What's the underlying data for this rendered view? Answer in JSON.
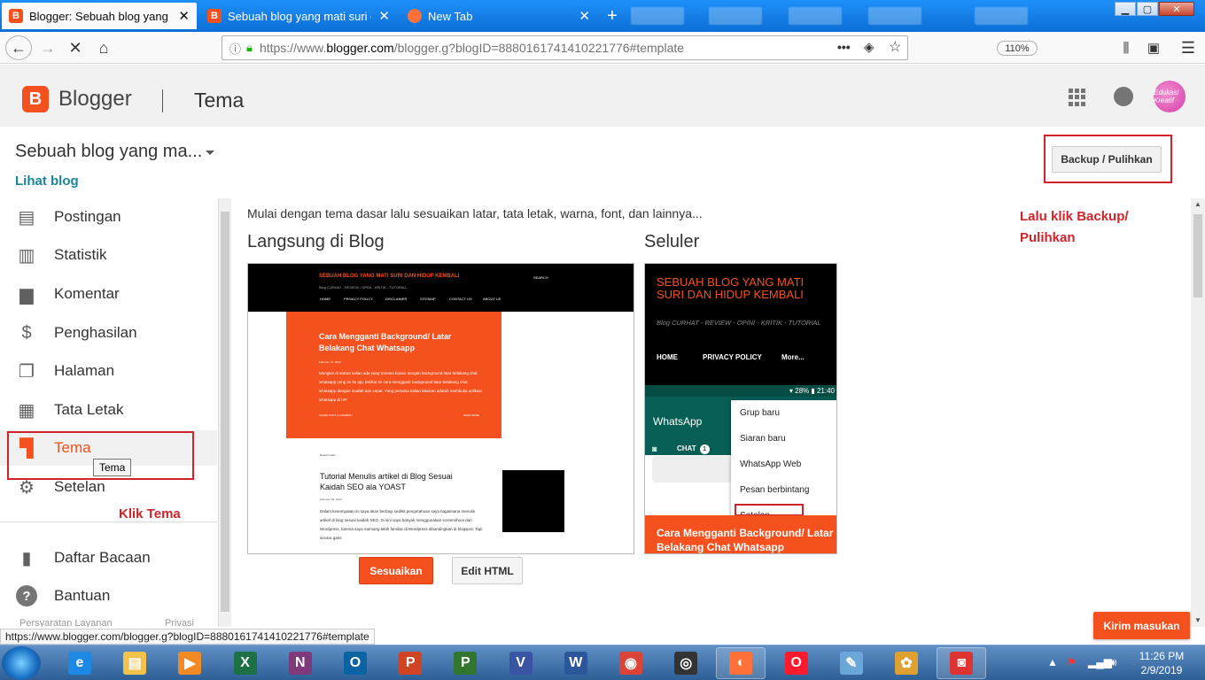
{
  "browser": {
    "tabs": [
      {
        "title": "Blogger: Sebuah blog yang mati suri dan hidup kembali",
        "close": "✕",
        "color": "#f4511e",
        "icon": "B"
      },
      {
        "title": "Sebuah blog yang mati suri dan hidup kembali",
        "close": "✕",
        "color": "#f4511e",
        "icon": "B"
      },
      {
        "title": "New Tab",
        "close": "✕",
        "color": "#ff7139",
        "icon": ""
      }
    ],
    "new_tab": "+",
    "url_prefix": "https://www.",
    "url_host": "blogger.com",
    "url_path": "/blogger.g?blogID=8880161741410221776#template",
    "zoom": "110%",
    "page_actions": "•••",
    "status_url": "https://www.blogger.com/blogger.g?blogID=8880161741410221776#template"
  },
  "header": {
    "logo_letter": "B",
    "app_name": "Blogger",
    "page_title": "Tema",
    "avatar_text": "Edukasi Kreatif"
  },
  "sidebar": {
    "blog_title": "Sebuah blog yang ma...",
    "view_blog": "Lihat blog",
    "items": [
      {
        "label": "Postingan",
        "icon": "▤"
      },
      {
        "label": "Statistik",
        "icon": "▥"
      },
      {
        "label": "Komentar",
        "icon": "▆"
      },
      {
        "label": "Penghasilan",
        "icon": "$"
      },
      {
        "label": "Halaman",
        "icon": "❐"
      },
      {
        "label": "Tata Letak",
        "icon": "▦"
      },
      {
        "label": "Tema",
        "icon": "▜"
      },
      {
        "label": "Setelan",
        "icon": "⚙"
      }
    ],
    "bottom_items": [
      {
        "label": "Daftar Bacaan",
        "icon": "▮"
      },
      {
        "label": "Bantuan",
        "icon": "?"
      }
    ],
    "footer_left": "Persyaratan Layanan",
    "footer_right": "Privasi",
    "tooltip": "Tema"
  },
  "annotations": {
    "click_theme": "Klik Tema",
    "click_backup_1": "Lalu klik Backup/",
    "click_backup_2": "Pulihkan"
  },
  "main": {
    "intro": "Mulai dengan tema dasar lalu sesuaikan latar, tata letak, warna, font, dan lainnya...",
    "live_heading": "Langsung di Blog",
    "mobile_heading": "Seluler",
    "backup_button": "Backup / Pulihkan",
    "customize_button": "Sesuaikan",
    "edit_html_button": "Edit HTML",
    "feedback_button": "Kirim masukan"
  },
  "desktop_preview": {
    "blog_title": "SEBUAH BLOG YANG MATI SURI DAN HIDUP KEMBALI",
    "blog_sub": "Blog CURHAT - REVIEW - OPINI - KRITIK - TUTORIAL",
    "search": "SEARCH",
    "nav": [
      "HOME",
      "PRIVACY POLICY",
      "DISCLAIMER",
      "SITEMAP",
      "CONTACT US",
      "ABOUT US"
    ],
    "card_title": "Cara Mengganti Background/ Latar Belakang Chat Whatsapp",
    "card_date": "February 07, 2019",
    "card_text": "Mungkin di antara kalian ada yang merasa bosan dengan background latar belakang chat whatsapp yang itu itu aja, berikut ini cara mengganti background latar belakang chat whatsapp dengan mudah dan cepat. Yang pertama kalian lakukan adalah membuka aplikasi whatsapp di HP",
    "card_share": "SHARE   POST A COMMENT",
    "card_more": "READ MORE",
    "recent": "Recent posts",
    "post_title": "Tutorial Menulis artikel di Blog Sesuai Kaidah SEO ala YOAST",
    "post_date": "February 04, 2019",
    "post_text": "Dalam kesempatan ini saya akan berbagi sedikit pengetahuan saya bagaimana menulis artikel di blog sesuai kaidah SEO. Di sini saya banyak menggunakan screenshoot dari Wordpress, karena saya memang lebih familiar di Wordpress dibandingkan di blogspot. Tapi secara garis"
  },
  "mobile_preview": {
    "blog_title": "SEBUAH BLOG YANG MATI SURI DAN HIDUP KEMBALI",
    "blog_sub": "Blog CURHAT - REVIEW - OPINI - KRITIK - TUTORIAL",
    "nav": [
      "HOME",
      "PRIVACY POLICY",
      "More..."
    ],
    "status": "▾ 28% ▮ 21:40",
    "wa_title": "WhatsApp",
    "chat_tab": "CHAT",
    "chat_count": "1",
    "menu": [
      "Grup baru",
      "Siaran baru",
      "WhatsApp Web",
      "Pesan berbintang",
      "Setelan"
    ],
    "card_title": "Cara Mengganti Background/ Latar Belakang Chat Whatsapp"
  },
  "taskbar": {
    "time": "11:26 PM",
    "date": "2/9/2019",
    "apps": [
      {
        "name": "internet-explorer",
        "glyph": "e",
        "color": "#1e88e5"
      },
      {
        "name": "file-explorer",
        "glyph": "▤",
        "color": "#f3c24b"
      },
      {
        "name": "media-player",
        "glyph": "▶",
        "color": "#f08a24"
      },
      {
        "name": "excel",
        "glyph": "X",
        "color": "#1d7044"
      },
      {
        "name": "onenote",
        "glyph": "N",
        "color": "#80397b"
      },
      {
        "name": "outlook",
        "glyph": "O",
        "color": "#0a64a4"
      },
      {
        "name": "powerpoint",
        "glyph": "P",
        "color": "#d04423"
      },
      {
        "name": "project",
        "glyph": "P",
        "color": "#31752f"
      },
      {
        "name": "visio",
        "glyph": "V",
        "color": "#3955a3"
      },
      {
        "name": "word",
        "glyph": "W",
        "color": "#2b579a"
      },
      {
        "name": "chrome",
        "glyph": "◉",
        "color": "#db4437"
      },
      {
        "name": "camera-app",
        "glyph": "◎",
        "color": "#333"
      },
      {
        "name": "firefox",
        "glyph": "◐",
        "color": "#ff7139"
      },
      {
        "name": "opera",
        "glyph": "O",
        "color": "#ff1b2d"
      },
      {
        "name": "notepad",
        "glyph": "✎",
        "color": "#6aa6d8"
      },
      {
        "name": "paint",
        "glyph": "✿",
        "color": "#e0a030"
      },
      {
        "name": "screenshot-tool",
        "glyph": "◙",
        "color": "#d33"
      }
    ]
  }
}
